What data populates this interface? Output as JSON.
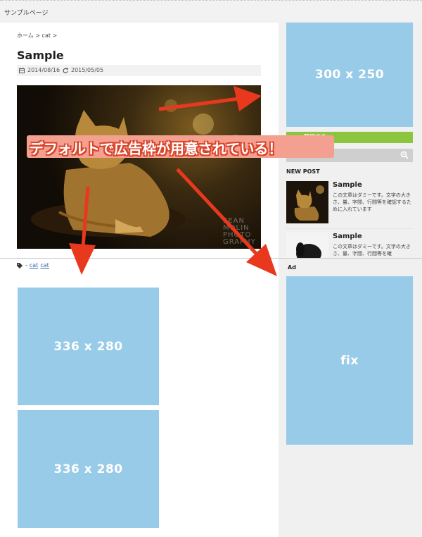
{
  "header": {
    "site_title": "サンプルページ"
  },
  "breadcrumb": {
    "text": "ホーム > cat >"
  },
  "article": {
    "title": "Sample",
    "published": "2014/08/16",
    "updated": "2015/05/05",
    "photo_watermark": "SEAN MOLIN PHOTO GRAPHY"
  },
  "tags": {
    "prefix": "-",
    "links": [
      "cat",
      "cat"
    ]
  },
  "ads": {
    "content_1": "336 x 280",
    "content_2": "336 x 280",
    "sidebar_top": "300 x 250",
    "sidebar_fix": "fix"
  },
  "sidebar": {
    "share_label": "◎ 購読する",
    "new_post_heading": "NEW POST",
    "posts": [
      {
        "title": "Sample",
        "excerpt": "この文章はダミーです。文字の大きさ、量、字間、行間等を確認するために入れています"
      },
      {
        "title": "Sample",
        "excerpt": "この文章はダミーです。文字の大きさ、量、字間、行間等を確"
      }
    ],
    "ad_label": "Ad"
  },
  "annotation": {
    "text": "デフォルトで広告枠が用意されている！"
  },
  "colors": {
    "ad_blue": "#98cbe8",
    "share_green": "#8cc63f",
    "arrow_red": "#e8381e"
  }
}
